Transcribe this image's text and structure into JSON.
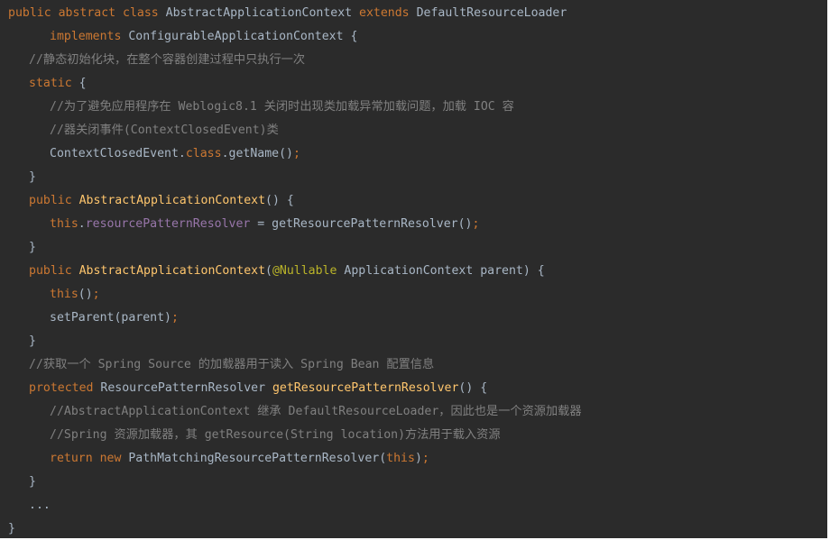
{
  "code": {
    "l1": {
      "kw1": "public abstract class ",
      "name": "AbstractApplicationContext ",
      "kw2": "extends ",
      "parent": "DefaultResourceLoader"
    },
    "l2": {
      "kw": "implements ",
      "rest": "ConfigurableApplicationContext {"
    },
    "l3": {
      "comment": "//静态初始化块，在整个容器创建过程中只执行一次"
    },
    "l4": {
      "kw": "static ",
      "rest": "{"
    },
    "l5": {
      "comment": "//为了避免应用程序在 Weblogic8.1 关闭时出现类加载异常加载问题，加载 IOC 容"
    },
    "l6": {
      "comment": "//器关闭事件(ContextClosedEvent)类"
    },
    "l7": {
      "a": "ContextClosedEvent.",
      "kw": "class",
      "b": ".getName()",
      "semi": ";"
    },
    "l8": {
      "text": "}"
    },
    "l9": {
      "kw": "public ",
      "fn": "AbstractApplicationContext",
      "rest": "() {"
    },
    "l10": {
      "kw": "this",
      "dot": ".",
      "field": "resourcePatternResolver",
      "rest": " = getResourcePatternResolver()",
      "semi": ";"
    },
    "l11": {
      "text": "}"
    },
    "l12": {
      "kw": "public ",
      "fn": "AbstractApplicationContext",
      "paren": "(",
      "ann": "@Nullable ",
      "rest": "ApplicationContext parent) {"
    },
    "l13": {
      "kw": "this",
      "rest": "()",
      "semi": ";"
    },
    "l14": {
      "rest": "setParent(parent)",
      "semi": ";"
    },
    "l15": {
      "text": "}"
    },
    "l16": {
      "comment": "//获取一个 Spring Source 的加载器用于读入 Spring Bean 配置信息"
    },
    "l17": {
      "kw": "protected ",
      "type": "ResourcePatternResolver ",
      "fn": "getResourcePatternResolver",
      "rest": "() {"
    },
    "l18": {
      "comment": "//AbstractApplicationContext 继承 DefaultResourceLoader，因此也是一个资源加载器"
    },
    "l19": {
      "comment": "//Spring 资源加载器，其 getResource(String location)方法用于载入资源"
    },
    "l20": {
      "kw1": "return ",
      "kw2": "new ",
      "cls": "PathMatchingResourcePatternResolver(",
      "kw3": "this",
      "close": ")",
      "semi": ";"
    },
    "l21": {
      "text": "}"
    },
    "l22": {
      "text": "..."
    },
    "l23": {
      "text": "}"
    }
  }
}
